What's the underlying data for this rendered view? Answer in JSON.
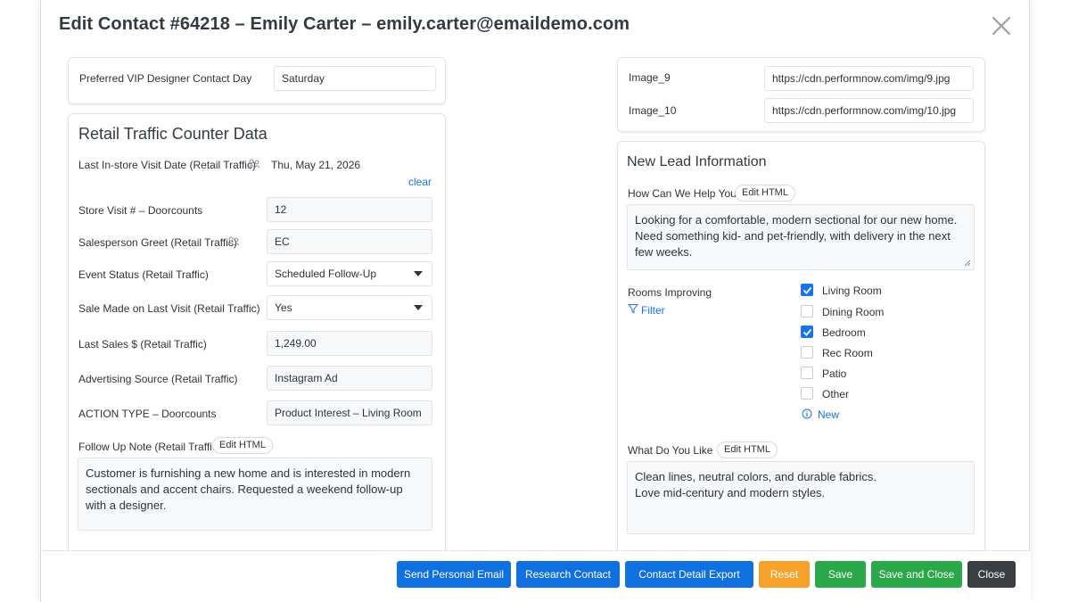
{
  "dialog": {
    "title": "Edit Contact #64218 – Emily Carter – emily.carter@emaildemo.com"
  },
  "vip": {
    "label": "Preferred VIP Designer Contact Day",
    "value": "Saturday"
  },
  "retail": {
    "title": "Retail Traffic Counter Data",
    "last_visit_label": "Last In-store Visit Date (Retail Traffic)",
    "last_visit_value": "Thu, May 21, 2026",
    "clear_label": "clear",
    "store_visit_label": "Store Visit # – Doorcounts",
    "store_visit_value": "12",
    "greet_label": "Salesperson Greet (Retail Traffic)",
    "greet_value": "EC",
    "event_label": "Event Status (Retail Traffic)",
    "event_value": "Scheduled Follow-Up",
    "sale_label": "Sale Made on Last Visit (Retail Traffic)",
    "sale_value": "Yes",
    "sales_amount_label": "Last Sales $ (Retail Traffic)",
    "sales_amount_value": "1,249.00",
    "adsource_label": "Advertising Source (Retail Traffic)",
    "adsource_value": "Instagram Ad",
    "action_label": "ACTION TYPE – Doorcounts",
    "action_value": "Product Interest – Living Room",
    "followup_label": "Follow Up Note (Retail Traffic)",
    "edit_html": "Edit HTML",
    "followup_lines": [
      "Customer is furnishing a new home and is interested in modern",
      "sectionals and accent chairs. Requested a weekend follow-up",
      "with a designer."
    ]
  },
  "images": {
    "image9_label": "Image_9",
    "image9_value": "https://cdn.performnow.com/img/9.jpg",
    "image10_label": "Image_10",
    "image10_value": "https://cdn.performnow.com/img/10.jpg"
  },
  "lead": {
    "title": "New Lead Information",
    "help_label": "How Can We Help You",
    "edit_html": "Edit HTML",
    "help_lines": [
      "Looking for a comfortable, modern sectional for our new home.",
      "Need something kid- and pet-friendly, with delivery in the next",
      "few weeks."
    ],
    "rooms_label": "Rooms Improving",
    "filter_label": "Filter",
    "rooms": [
      {
        "label": "Living Room",
        "checked": true
      },
      {
        "label": "Dining Room",
        "checked": false
      },
      {
        "label": "Bedroom",
        "checked": true
      },
      {
        "label": "Rec Room",
        "checked": false
      },
      {
        "label": "Patio",
        "checked": false
      },
      {
        "label": "Other",
        "checked": false
      }
    ],
    "new_label": "New",
    "like_label": "What Do You Like",
    "like_lines": [
      "Clean lines, neutral colors, and durable fabrics.",
      "Love mid-century and modern styles."
    ]
  },
  "footer": {
    "send_email": "Send Personal Email",
    "research": "Research Contact",
    "export": "Contact Detail Export",
    "reset": "Reset",
    "save": "Save",
    "save_close": "Save and Close",
    "close": "Close"
  },
  "colors": {
    "blue": "#1170e0",
    "orange": "#f5a12a",
    "green": "#2aa84a",
    "dark": "#3a3f44",
    "link": "#1a73e8"
  },
  "icons": [
    "close-icon",
    "people-icon",
    "caret-down-icon",
    "filter-icon",
    "info-icon",
    "checkmark-icon"
  ]
}
